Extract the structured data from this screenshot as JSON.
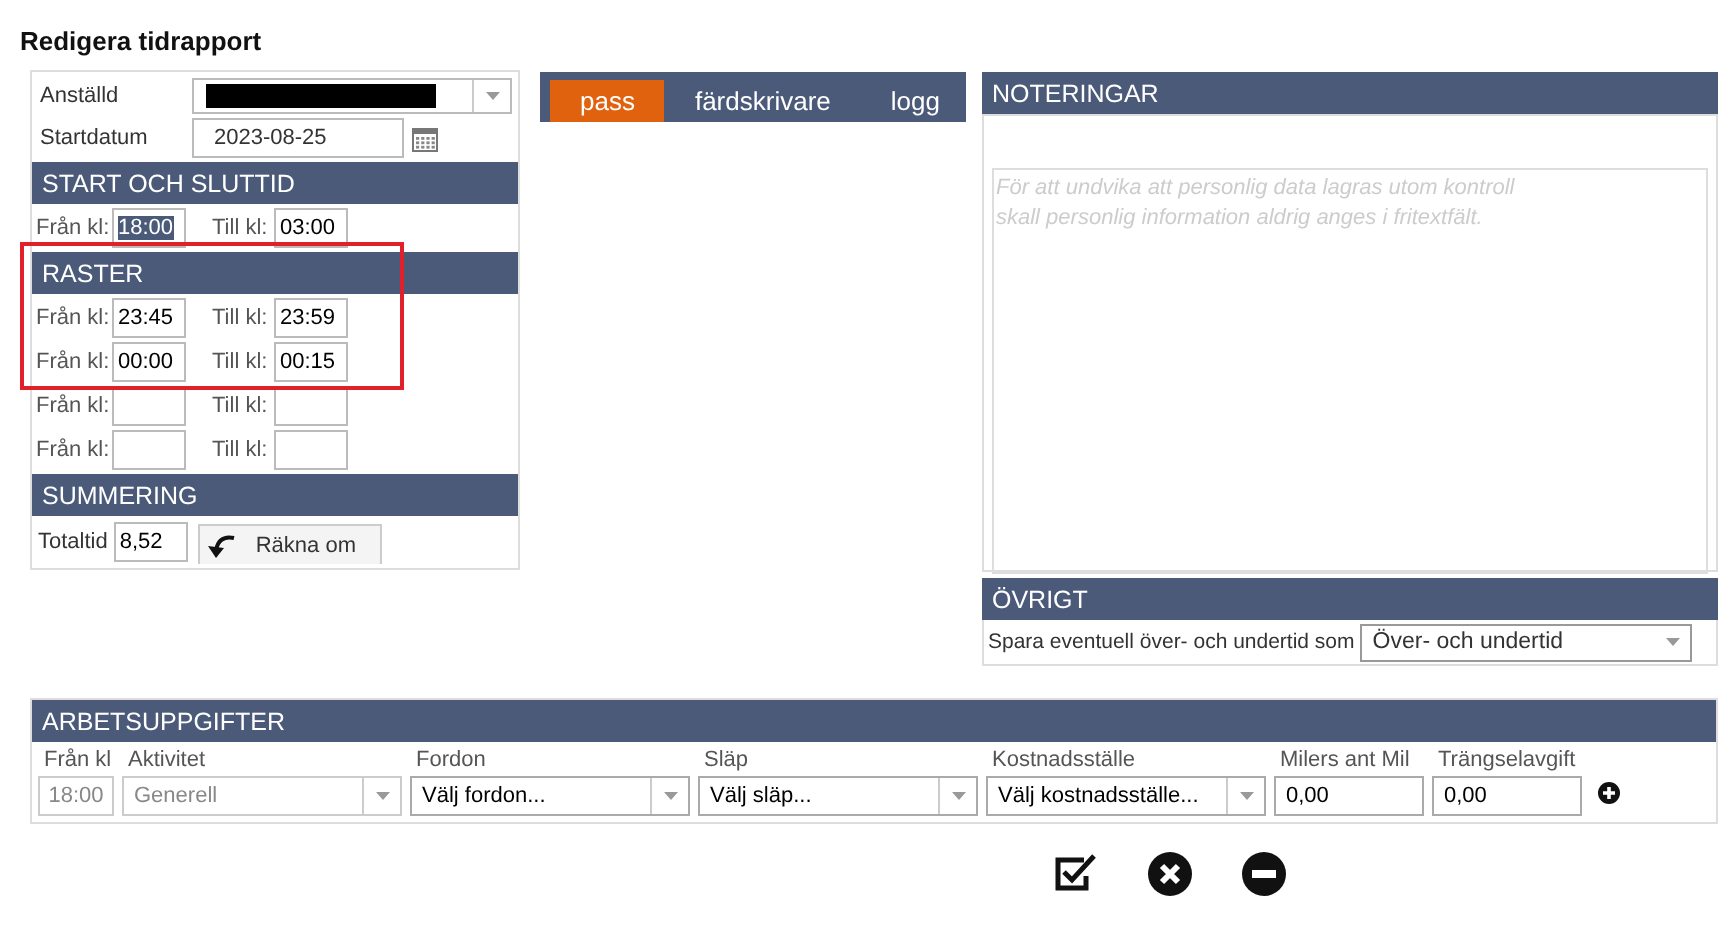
{
  "title": "Redigera tidrapport",
  "employee": {
    "label": "Anställd",
    "redacted": true
  },
  "start_date": {
    "label": "Startdatum",
    "value": "2023-08-25"
  },
  "start_end": {
    "header": "START OCH SLUTTID",
    "from_label": "Från kl:",
    "from": "18:00",
    "from_selected": true,
    "to_label": "Till kl:",
    "to": "03:00"
  },
  "breaks": {
    "header": "RASTER",
    "highlighted": true,
    "rows": [
      {
        "from_label": "Från kl:",
        "from": "23:45",
        "to_label": "Till kl:",
        "to": "23:59",
        "marked": true
      },
      {
        "from_label": "Från kl:",
        "from": "00:00",
        "to_label": "Till kl:",
        "to": "00:15",
        "marked": true
      },
      {
        "from_label": "Från kl:",
        "to_label": "Till kl:",
        "marked": false
      },
      {
        "from_label": "Från kl:",
        "to_label": "Till kl:",
        "marked": false
      }
    ]
  },
  "summary": {
    "header": "SUMMERING",
    "label": "Totaltid",
    "value": "8,52",
    "button": "Räkna om"
  },
  "tabs": [
    {
      "label": "pass",
      "selected": true
    },
    {
      "label": "färdskrivare",
      "selected": false
    },
    {
      "label": "logg",
      "selected": false
    }
  ],
  "notes": {
    "header": "NOTERINGAR",
    "placeholder": "För att undvika att personlig data lagras utom kontroll\nskall personlig information aldrig anges i fritextfält."
  },
  "other": {
    "header": "ÖVRIGT",
    "label": "Spara eventuell över- och undertid som",
    "value": "Över- och undertid"
  },
  "tasks": {
    "header": "ARBETSUPPGIFTER",
    "columns": [
      {
        "label": "Från kl",
        "kind": "input",
        "value": "18:00",
        "disabled": true
      },
      {
        "label": "Aktivitet",
        "kind": "select",
        "value": "Generell",
        "disabled": true
      },
      {
        "label": "Fordon",
        "kind": "select",
        "value": "Välj fordon...",
        "disabled": false
      },
      {
        "label": "Släp",
        "kind": "select",
        "value": "Välj släp...",
        "disabled": false
      },
      {
        "label": "Kostnadsställe",
        "kind": "select",
        "value": "Välj kostnadsställe...",
        "disabled": false
      },
      {
        "label": "Milers ant Mil",
        "kind": "input",
        "value": "0,00",
        "disabled": false
      },
      {
        "label": "Trängselavgift",
        "kind": "input",
        "value": "0,00",
        "disabled": false
      }
    ]
  }
}
